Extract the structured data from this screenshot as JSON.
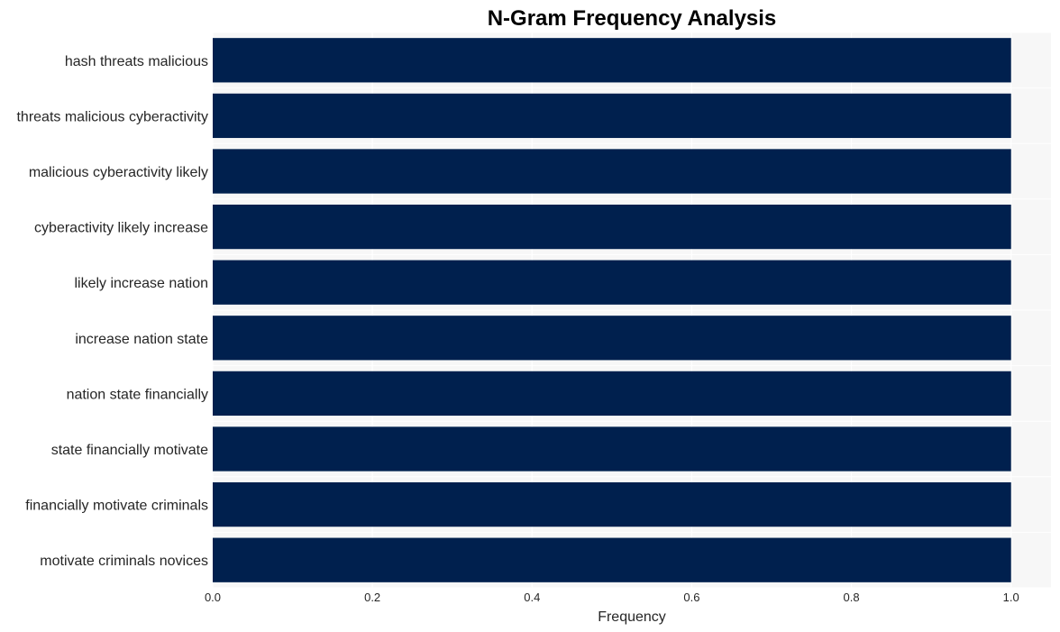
{
  "chart_data": {
    "type": "bar",
    "orientation": "horizontal",
    "title": "N-Gram Frequency Analysis",
    "xlabel": "Frequency",
    "ylabel": "",
    "categories": [
      "hash threats malicious",
      "threats malicious cyberactivity",
      "malicious cyberactivity likely",
      "cyberactivity likely increase",
      "likely increase nation",
      "increase nation state",
      "nation state financially",
      "state financially motivate",
      "financially motivate criminals",
      "motivate criminals novices"
    ],
    "values": [
      1,
      1,
      1,
      1,
      1,
      1,
      1,
      1,
      1,
      1
    ],
    "xlim": [
      0,
      1.05
    ],
    "xticks": [
      0.0,
      0.2,
      0.4,
      0.6,
      0.8,
      1.0
    ],
    "xtick_labels": [
      "0.0",
      "0.2",
      "0.4",
      "0.6",
      "0.8",
      "1.0"
    ],
    "grid": true,
    "legend": "none",
    "colors": {
      "bar": "#00204e",
      "plot_background": "#f7f7f7",
      "grid": "#ffffff"
    }
  }
}
